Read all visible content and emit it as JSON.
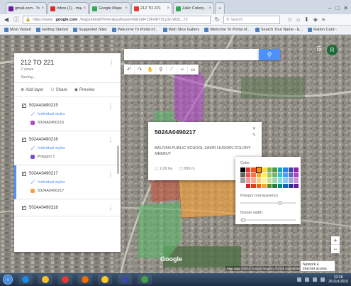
{
  "browser": {
    "tabs": [
      {
        "label": "gmail.com - Yaho...",
        "color": "#6a1b9a",
        "active": false
      },
      {
        "label": "Inbox (1) - mapme...",
        "color": "#d32f2f",
        "active": false
      },
      {
        "label": "Google Maps",
        "color": "#34a853",
        "active": false
      },
      {
        "label": "212 TO 221",
        "color": "#e53935",
        "active": true
      },
      {
        "label": "Zakir Colony - Go...",
        "color": "#34a853",
        "active": false
      }
    ],
    "url_domain": "google.com",
    "url_prefix": "https://www.",
    "url_rest": "/maps/d/edit?hl=en&authuser=0&mid=1SFdRY2Ly3z-WDL_TZ",
    "search_placeholder": "Search",
    "bookmarks": [
      "Most Visited",
      "Getting Started",
      "Suggested Sites",
      "Welcome To Portal of...",
      "Web Slice Gallery",
      "Welcome To Portal of...",
      "Search Your Name - E...",
      "Ration Card -"
    ]
  },
  "panel": {
    "title": "212 TO 221",
    "subtitle": "2 views",
    "status": "Saving...",
    "actions": {
      "add_layer": "Add layer",
      "share": "Share",
      "preview": "Preview"
    },
    "layers": [
      {
        "name": "5024A0490215",
        "styles": "Individual styles",
        "feature": "5024A0490215",
        "color": "#b048c8",
        "selected": false
      },
      {
        "name": "5024A0490216",
        "styles": "Individual styles",
        "feature": "Polygon 1",
        "color": "#7b4fd3",
        "selected": false
      },
      {
        "name": "5024A0490217",
        "styles": "Individual styles",
        "feature": "5024A0490217",
        "color": "#f4a13a",
        "selected": true
      },
      {
        "name": "5024A0490218",
        "styles": "",
        "feature": "",
        "color": "#888888",
        "selected": false
      }
    ]
  },
  "info_card": {
    "title": "5024A0490217",
    "description": "BALIYAN PUBLIC SCHOOL ZAKIR HUSSAN COLONY MEERUT",
    "stat_area": "1.09 ha",
    "stat_perimeter": "500 m"
  },
  "color_popup": {
    "color_label": "Color",
    "transparency_label": "Polygon transparency",
    "transparency_value": 0.72,
    "border_label": "Border width",
    "border_value": 0.05,
    "swatches": [
      "#000000",
      "#e53935",
      "#f4511e",
      "#fb8c00",
      "#fdd835",
      "#7cb342",
      "#43a047",
      "#00acc1",
      "#1e88e5",
      "#3949ab",
      "#8e24aa",
      "#616161",
      "#ef5350",
      "#ff7043",
      "#ffa726",
      "#ffee58",
      "#9ccc65",
      "#66bb6a",
      "#26c6da",
      "#42a5f5",
      "#5c6bc0",
      "#ab47bc",
      "#9e9e9e",
      "#ef9a9a",
      "#ffab91",
      "#ffcc80",
      "#fff59d",
      "#c5e1a5",
      "#a5d6a7",
      "#80deea",
      "#90caf9",
      "#9fa8da",
      "#ce93d8",
      "#ffffff",
      "#c62828",
      "#d84315",
      "#ef6c00",
      "#f9a825",
      "#558b2f",
      "#2e7d32",
      "#00838f",
      "#1565c0",
      "#283593",
      "#6a1b9a"
    ],
    "selected_swatch": 3
  },
  "map": {
    "google_label": "Google",
    "footer": "Map data ©2016 Google Imagery ©2016 DigitalGlobe",
    "network_label": "Network 4",
    "network_sub": "Internet access",
    "avatar_letter": "R"
  },
  "taskbar": {
    "apps": [
      "#1e88e5",
      "#fbc02d",
      "#e53935",
      "#ef6c00",
      "#ffca28",
      "#3949ab",
      "#43a047"
    ],
    "time": "22:28",
    "date": "26-Oct-2016"
  },
  "colors": {
    "accent": "#4d90fe",
    "polygon_purple": "#b048c8",
    "polygon_orange": "#f4a13a",
    "polygon_green": "#5bb76a",
    "polygon_red": "#c8553d"
  }
}
